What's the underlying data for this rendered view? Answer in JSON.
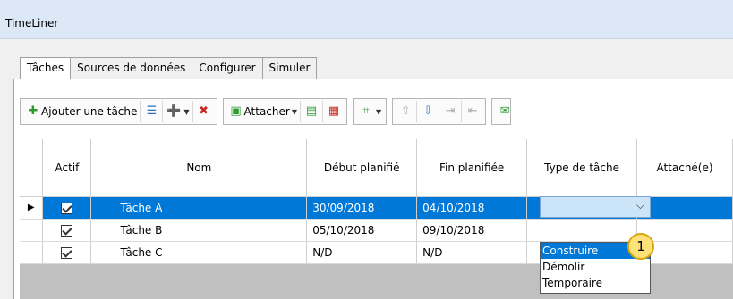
{
  "window": {
    "title": "TimeLiner"
  },
  "tabs": [
    {
      "label": "Tâches",
      "active": true
    },
    {
      "label": "Sources de données"
    },
    {
      "label": "Configurer"
    },
    {
      "label": "Simuler"
    }
  ],
  "toolbar": {
    "add_task_label": "Ajouter une tâche",
    "attach_label": "Attacher",
    "icons": [
      "add-task-icon",
      "auto-add-tasks-icon",
      "insert-task-icon",
      "delete-task-icon",
      "attach-icon",
      "auto-attach-icon",
      "clear-attach-icon",
      "find-items-icon",
      "move-up-icon",
      "move-down-icon",
      "indent-icon",
      "outdent-icon",
      "comment-icon"
    ]
  },
  "grid": {
    "columns": [
      "Actif",
      "Nom",
      "Début planifié",
      "Fin planifiée",
      "Type de tâche",
      "Attaché(e)"
    ],
    "rows": [
      {
        "active": true,
        "name": "Tâche A",
        "start": "30/09/2018",
        "end": "04/10/2018",
        "type": "",
        "attached": ""
      },
      {
        "active": true,
        "name": "Tâche B",
        "start": "05/10/2018",
        "end": "09/10/2018",
        "type": "",
        "attached": ""
      },
      {
        "active": true,
        "name": "Tâche C",
        "start": "N/D",
        "end": "N/D",
        "type": "",
        "attached": ""
      }
    ]
  },
  "dropdown": {
    "options": [
      "Construire",
      "Démolir",
      "Temporaire"
    ],
    "highlighted": "Construire"
  },
  "callout": {
    "label": "1"
  },
  "colors": {
    "selection": "#0078d7",
    "callout": "#fde27a"
  }
}
